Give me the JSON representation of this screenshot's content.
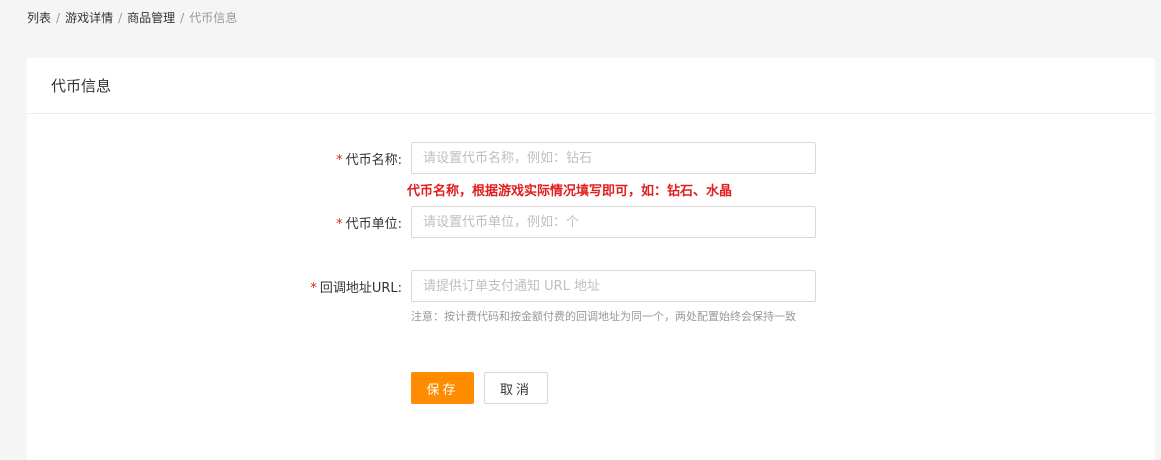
{
  "breadcrumb": {
    "items": [
      "列表",
      "游戏详情",
      "商品管理"
    ],
    "current": "代币信息",
    "separator": "/"
  },
  "card": {
    "title": "代币信息"
  },
  "form": {
    "required_mark": "*",
    "currency_name": {
      "label": "代币名称:",
      "placeholder": "请设置代币名称，例如：钻石",
      "value": "",
      "hint": "代币名称，根据游戏实际情况填写即可，如：钻石、水晶"
    },
    "currency_unit": {
      "label": "代币单位:",
      "placeholder": "请设置代币单位，例如：个",
      "value": ""
    },
    "callback_url": {
      "label": "回调地址URL:",
      "placeholder": "请提供订单支付通知 URL 地址",
      "value": "",
      "note": "注意：按计费代码和按金额付费的回调地址为同一个，两处配置始终会保持一致"
    }
  },
  "actions": {
    "save_label": "保存",
    "cancel_label": "取消"
  },
  "colors": {
    "primary": "#ff8c00",
    "required": "#e02020",
    "background": "#f5f5f5"
  }
}
